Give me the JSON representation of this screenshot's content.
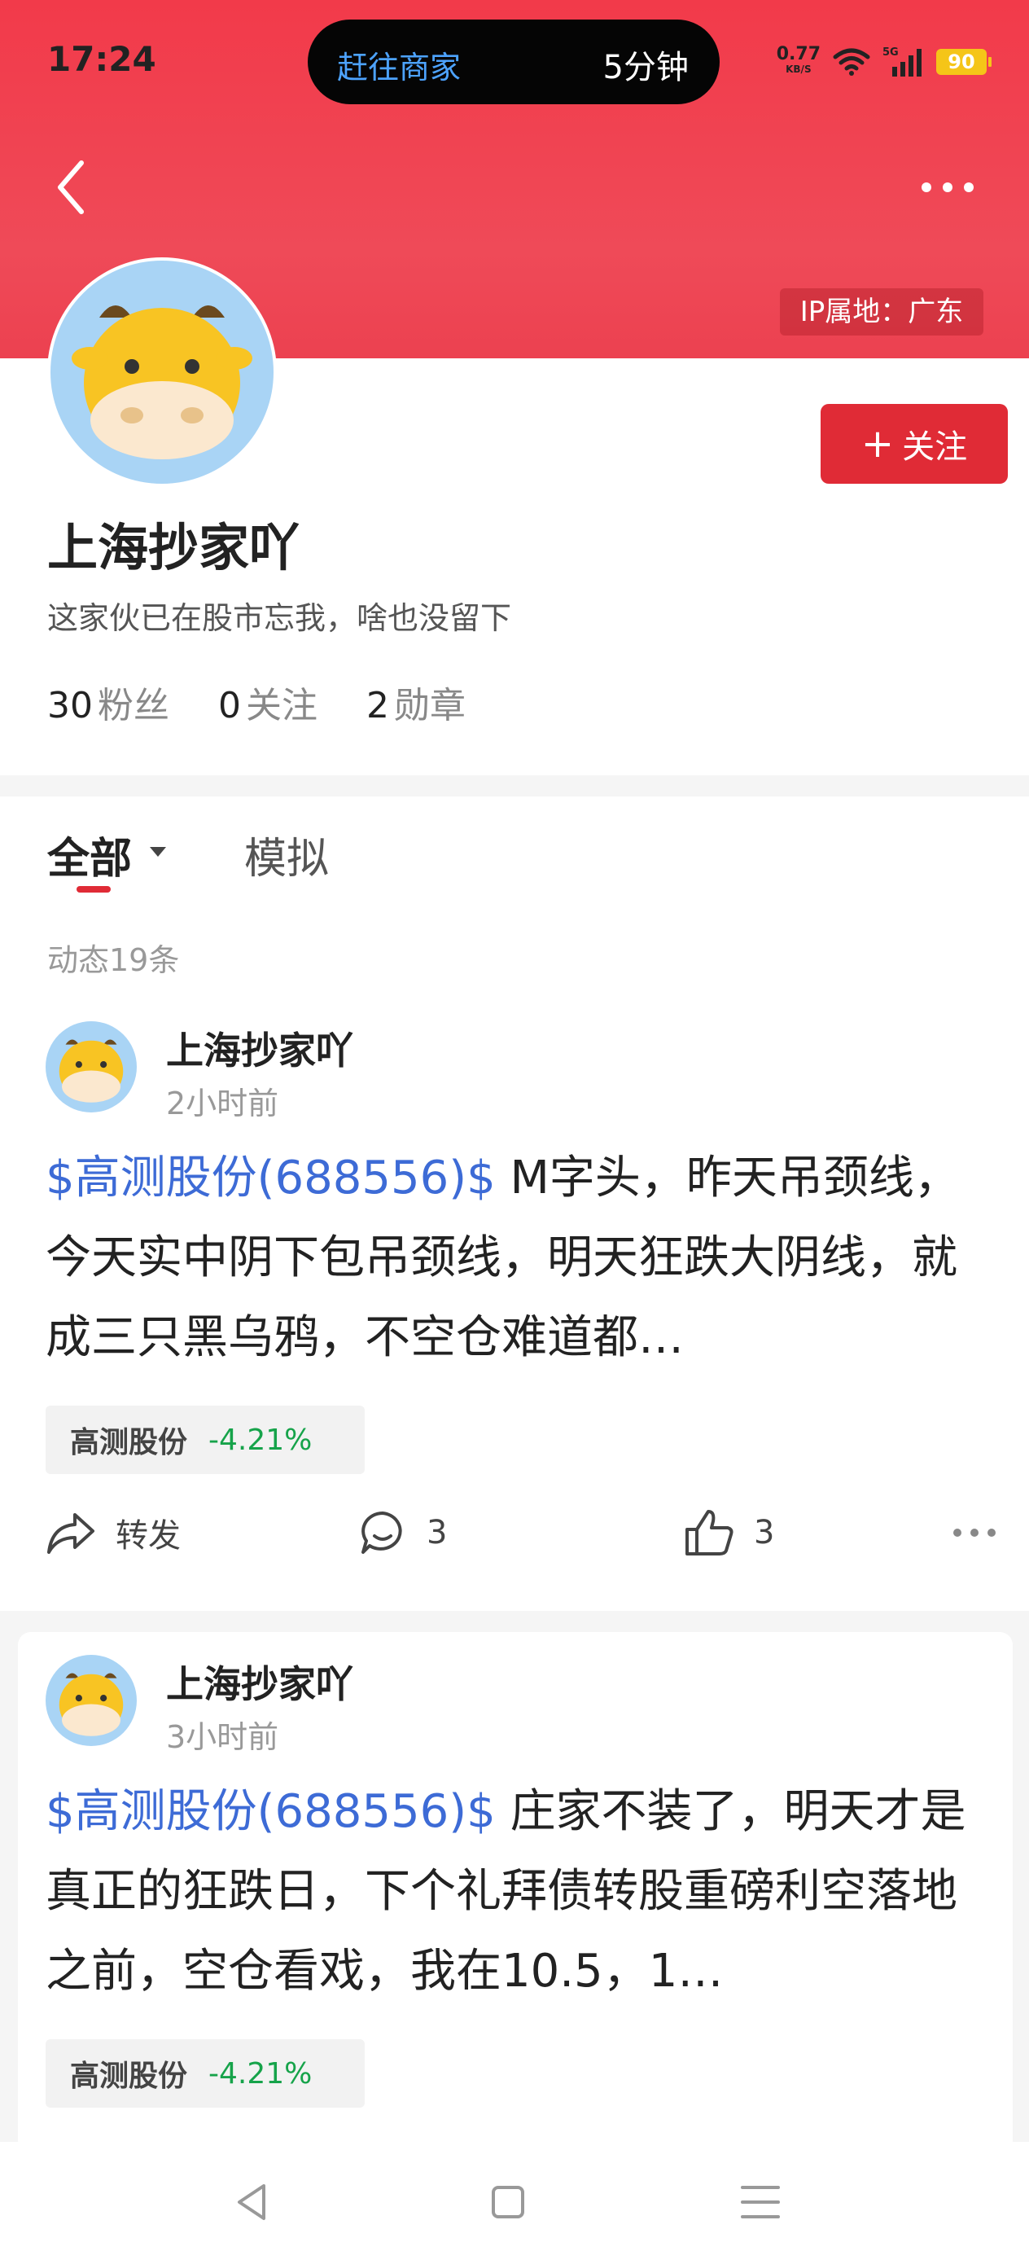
{
  "status_bar": {
    "time": "17:24",
    "pill_left": "赶往商家",
    "pill_right": "5分钟",
    "net_speed_value": "0.77",
    "net_speed_unit": "KB/S",
    "signal_label": "5G",
    "battery": "90"
  },
  "header": {
    "ip_label": "IP属地：广东",
    "icons": [
      "back-arrow-icon",
      "more-dots-icon"
    ]
  },
  "profile": {
    "username": "上海抄家吖",
    "bio": "这家伙已在股市忘我，啥也没留下",
    "follow_label": "关注",
    "stats": [
      {
        "num": "30",
        "label": "粉丝"
      },
      {
        "num": "0",
        "label": "关注"
      },
      {
        "num": "2",
        "label": "勋章"
      }
    ]
  },
  "tabs": {
    "all": "全部",
    "sim": "模拟",
    "feed_count": "动态19条"
  },
  "posts": [
    {
      "author": "上海抄家吖",
      "time": "2小时前",
      "stock_link": "$高测股份(688556)$",
      "text": " M字头，昨天吊颈线，今天实中阴下包吊颈线，明天狂跌大阴线，就成三只黑乌鸦，不空仓难道都…",
      "tag_name": "高测股份",
      "tag_change": "-4.21%",
      "forward_label": "转发",
      "comments": "3",
      "likes": "3"
    },
    {
      "author": "上海抄家吖",
      "time": "3小时前",
      "stock_link": "$高测股份(688556)$",
      "text": " 庄家不装了，明天才是真正的狂跌日，下个礼拜债转股重磅利空落地之前，空仓看戏，我在10.5，1…",
      "tag_name": "高测股份",
      "tag_change": "-4.21%"
    }
  ],
  "colors": {
    "brand_red": "#e02b36",
    "link_blue": "#3d6bd6",
    "fall_green": "#16a34a"
  }
}
